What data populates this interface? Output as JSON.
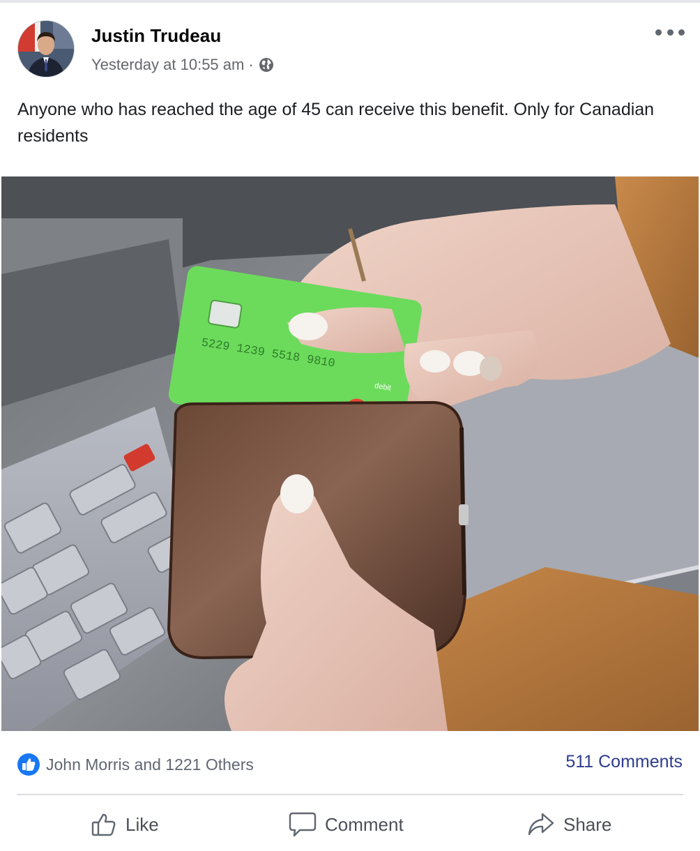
{
  "post": {
    "author": "Justin Trudeau",
    "timestamp": "Yesterday at 10:55 am",
    "separator": "·",
    "privacy_icon": "globe-icon",
    "more_icon": "more-options-icon",
    "text": "Anyone who has reached the age of 45 can receive this benefit. Only for Canadian residents",
    "card_number": "5229 1239 5518 9810",
    "card_brand_text": "debit"
  },
  "engagement": {
    "reaction_icon": "like-reaction-icon",
    "reactions_text": "John Morris and 1221 Others",
    "comments_text": "511 Comments"
  },
  "actions": {
    "like_label": "Like",
    "comment_label": "Comment",
    "share_label": "Share"
  },
  "colors": {
    "facebook_blue": "#1877f2",
    "link_blue": "#2d3c8c",
    "secondary_text": "#65676b",
    "card_green": "#6cdb5c"
  }
}
